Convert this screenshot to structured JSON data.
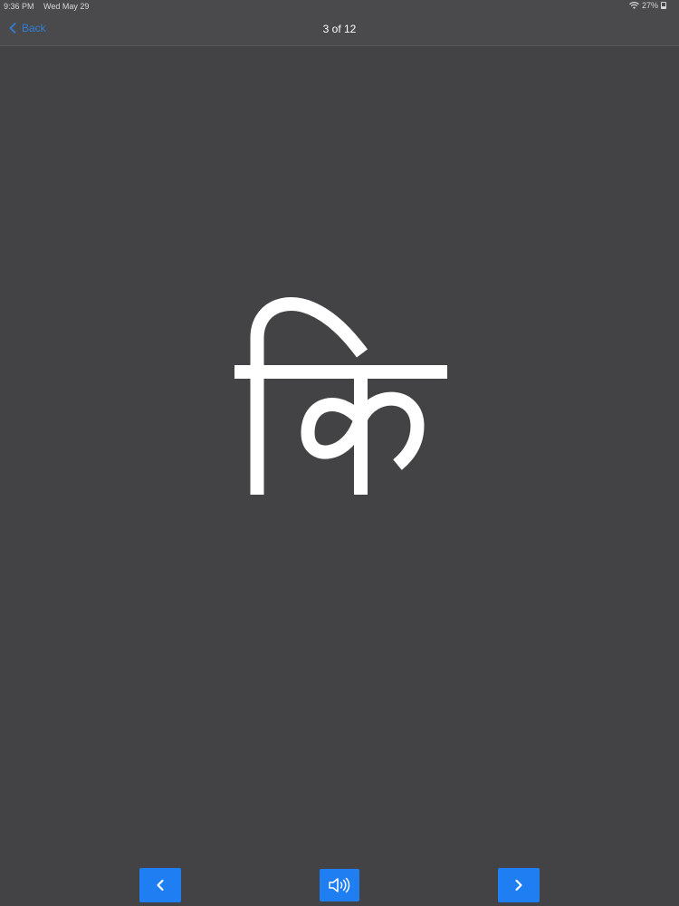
{
  "status_bar": {
    "time": "9:36 PM",
    "date": "Wed May 29",
    "battery": "27%"
  },
  "nav": {
    "back_label": "Back",
    "title": "3 of 12"
  },
  "card": {
    "glyph": "कि"
  },
  "controls": {
    "prev_icon": "chevron-left-icon",
    "audio_icon": "speaker-icon",
    "next_icon": "chevron-right-icon"
  },
  "colors": {
    "background": "#434244",
    "accent": "#1e7ef2",
    "link": "#2f7fd8"
  }
}
